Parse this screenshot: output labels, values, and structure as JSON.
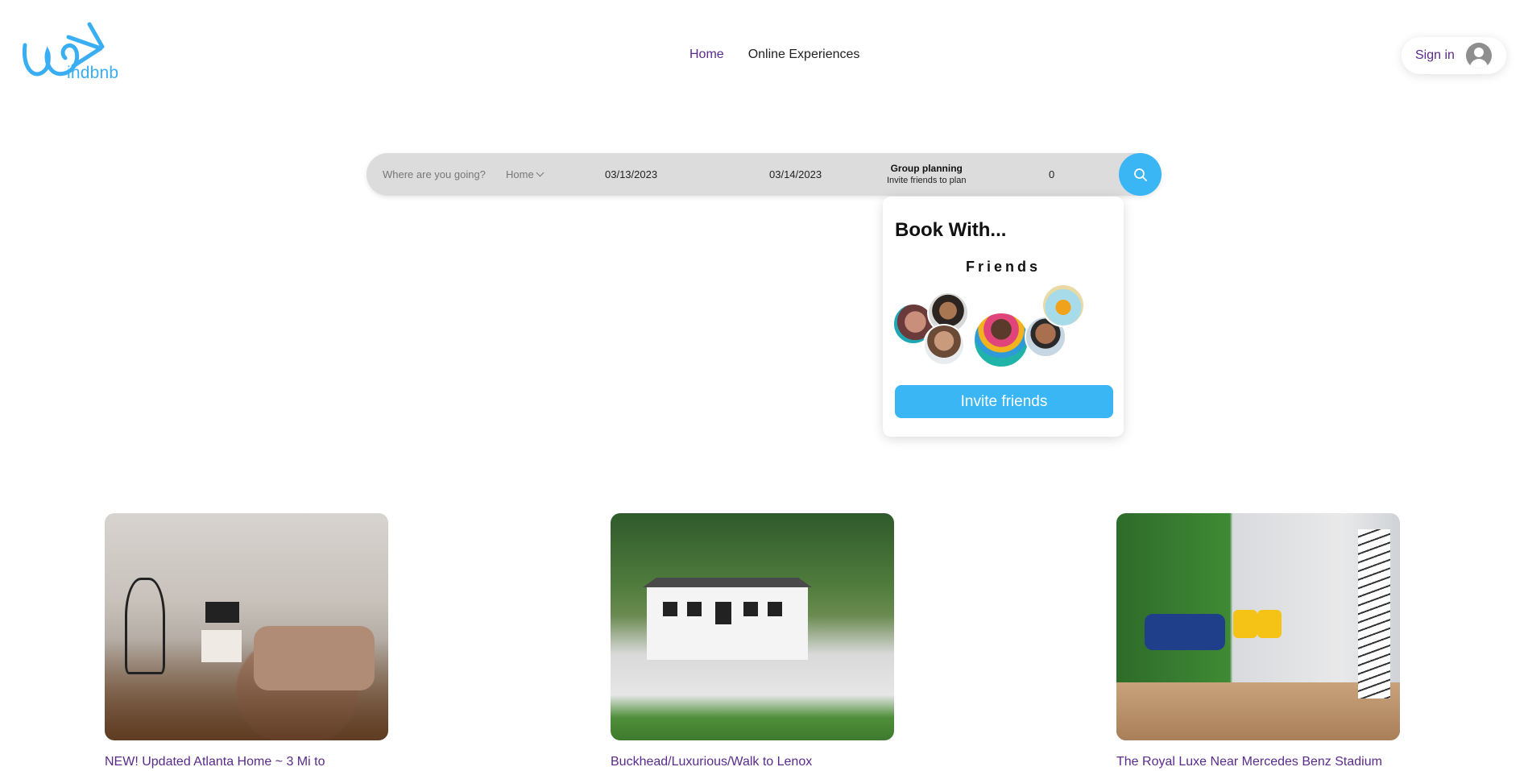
{
  "brand": {
    "logo_text": "indbnb",
    "accent": "#3aaef2"
  },
  "nav": {
    "home": "Home",
    "experiences": "Online Experiences"
  },
  "account": {
    "sign_in": "Sign in",
    "icon": "user-avatar-icon"
  },
  "search": {
    "where_placeholder": "Where are you going?",
    "type": "Home",
    "check_in": "03/13/2023",
    "check_out": "03/14/2023",
    "group_title": "Group planning",
    "group_subtitle": "Invite friends to plan",
    "guests": "0",
    "button_icon": "search-icon"
  },
  "popup": {
    "title": "Book With...",
    "subtitle": "Friends",
    "button": "Invite friends"
  },
  "listings": [
    {
      "title": "NEW! Updated Atlanta Home ~ 3 Mi to"
    },
    {
      "title": "Buckhead/Luxurious/Walk to Lenox"
    },
    {
      "title": "The Royal Luxe Near Mercedes Benz Stadium"
    }
  ]
}
